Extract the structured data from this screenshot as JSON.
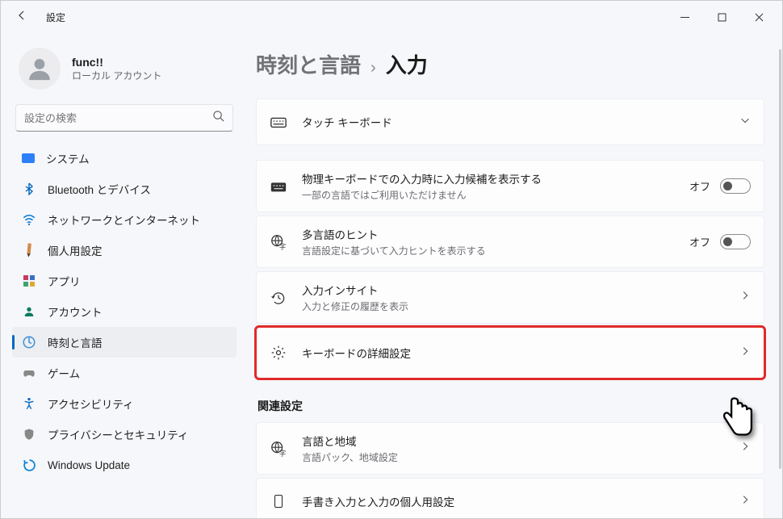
{
  "window": {
    "title": "設定"
  },
  "profile": {
    "name": "func!!",
    "sub": "ローカル アカウント"
  },
  "search": {
    "placeholder": "設定の検索"
  },
  "nav": {
    "system": "システム",
    "bluetooth": "Bluetooth とデバイス",
    "network": "ネットワークとインターネット",
    "personalization": "個人用設定",
    "apps": "アプリ",
    "accounts": "アカウント",
    "time": "時刻と言語",
    "gaming": "ゲーム",
    "accessibility": "アクセシビリティ",
    "privacy": "プライバシーとセキュリティ",
    "update": "Windows Update"
  },
  "breadcrumb": {
    "parent": "時刻と言語",
    "current": "入力"
  },
  "cards": {
    "touchkb": {
      "title": "タッチ キーボード"
    },
    "physkb": {
      "title": "物理キーボードでの入力時に入力候補を表示する",
      "sub": "一部の言語ではご利用いただけません",
      "state": "オフ"
    },
    "multi": {
      "title": "多言語のヒント",
      "sub": "言語設定に基づいて入力ヒントを表示する",
      "state": "オフ"
    },
    "insight": {
      "title": "入力インサイト",
      "sub": "入力と修正の履歴を表示"
    },
    "advkb": {
      "title": "キーボードの詳細設定"
    },
    "related_heading": "関連設定",
    "langregion": {
      "title": "言語と地域",
      "sub": "言語パック、地域設定"
    },
    "handwriting": {
      "title": "手書き入力と入力の個人用設定"
    }
  }
}
